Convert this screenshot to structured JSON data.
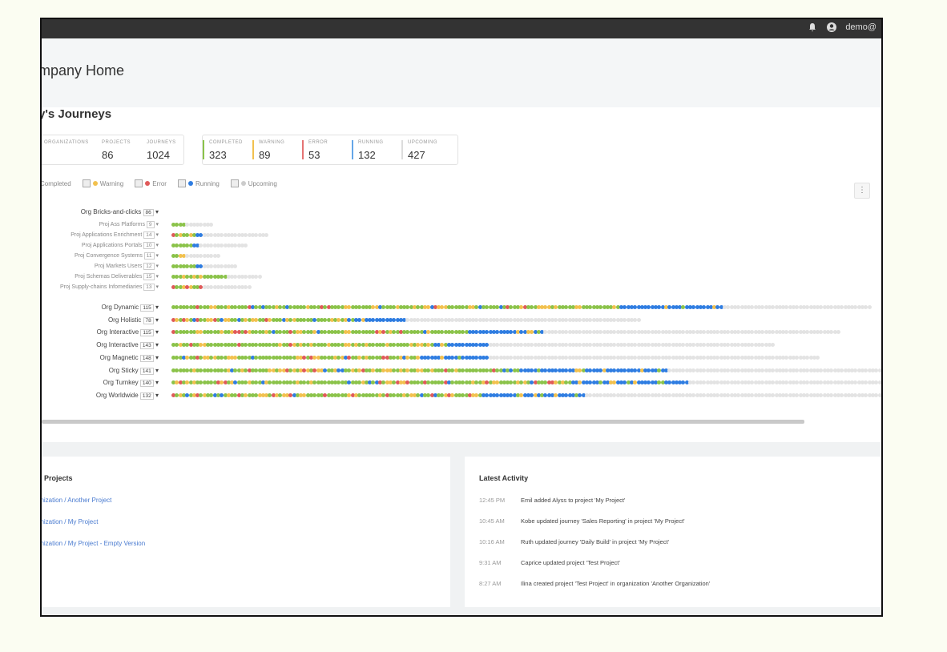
{
  "topbar": {
    "user": "demo@"
  },
  "header": {
    "title": "mpany Home"
  },
  "journeys": {
    "title": "y's Journeys",
    "stats_left": [
      {
        "label": "ORGANIZATIONS",
        "value": ""
      },
      {
        "label": "PROJECTS",
        "value": "86"
      },
      {
        "label": "JOURNEYS",
        "value": "1024"
      }
    ],
    "stats_right": [
      {
        "label": "COMPLETED",
        "value": "323",
        "color": "#8bc34a"
      },
      {
        "label": "WARNING",
        "value": "89",
        "color": "#f2c14e"
      },
      {
        "label": "ERROR",
        "value": "53",
        "color": "#e57373"
      },
      {
        "label": "RUNNING",
        "value": "132",
        "color": "#64a6e8"
      },
      {
        "label": "UPCOMING",
        "value": "427",
        "color": "#dddddd"
      }
    ],
    "legend": [
      {
        "label": "Completed",
        "color": "#8bc34a"
      },
      {
        "label": "Warning",
        "color": "#f2c14e"
      },
      {
        "label": "Error",
        "color": "#e05a5a"
      },
      {
        "label": "Running",
        "color": "#2f7de1"
      },
      {
        "label": "Upcoming",
        "color": "#cccccc"
      }
    ],
    "org_group": {
      "label": "Org Bricks-and-clicks",
      "count": "86"
    },
    "projects": [
      {
        "label": "Proj Ass Platforms",
        "count": "9",
        "pattern": "GGGG",
        "total": 12
      },
      {
        "label": "Proj Applications Enrichment",
        "count": "14",
        "pattern": "RGYGGYGBB",
        "total": 28
      },
      {
        "label": "Proj Applications Portals",
        "count": "10",
        "pattern": "GGGGGGBB",
        "total": 22
      },
      {
        "label": "Proj Convergence Systems",
        "count": "11",
        "pattern": "GGYY",
        "total": 14
      },
      {
        "label": "Proj Markets Users",
        "count": "12",
        "pattern": "GGGGGGGBB",
        "total": 19
      },
      {
        "label": "Proj Schemas Deliverables",
        "count": "15",
        "pattern": "GGGYGGYGYGGGGGGG",
        "total": 26
      },
      {
        "label": "Proj Supply-chains Infomediaries",
        "count": "13",
        "pattern": "RGGYRYGGR",
        "total": 23
      }
    ],
    "orgs": [
      {
        "label": "Org Dynamic",
        "count": "115",
        "total": 203,
        "done": 130,
        "running": 30
      },
      {
        "label": "Org Holistic",
        "count": "78",
        "total": 136,
        "done": 50,
        "running": 18
      },
      {
        "label": "Org Interactive",
        "count": "115",
        "total": 194,
        "done": 86,
        "running": 22
      },
      {
        "label": "Org Interactive",
        "count": "143",
        "total": 175,
        "done": 74,
        "running": 18
      },
      {
        "label": "Org Magnetic",
        "count": "148",
        "total": 188,
        "done": 72,
        "running": 20
      },
      {
        "label": "Org Sticky",
        "count": "141",
        "total": 213,
        "done": 96,
        "running": 48
      },
      {
        "label": "Org Turnkey",
        "count": "140",
        "total": 213,
        "done": 116,
        "running": 34
      },
      {
        "label": "Org Worldwide",
        "count": "132",
        "total": 213,
        "done": 90,
        "running": 30
      }
    ]
  },
  "projects_panel": {
    "title": "l Projects",
    "links": [
      "anization / Another Project",
      "anization / My Project",
      "anization / My Project - Empty Version"
    ]
  },
  "activity_panel": {
    "title": "Latest Activity",
    "items": [
      {
        "time": "12:45 PM",
        "text": "Emil added Alyss to project 'My Project'"
      },
      {
        "time": "10:45 AM",
        "text": "Kobe updated journey 'Sales Reporting' in project 'My Project'"
      },
      {
        "time": "10:16 AM",
        "text": "Ruth updated journey 'Daily Build' in project 'My Project'"
      },
      {
        "time": "9:31 AM",
        "text": "Caprice updated project 'Test Project'"
      },
      {
        "time": "8:27 AM",
        "text": "Ilina created project 'Test Project' in organization 'Another Organization'"
      }
    ]
  }
}
